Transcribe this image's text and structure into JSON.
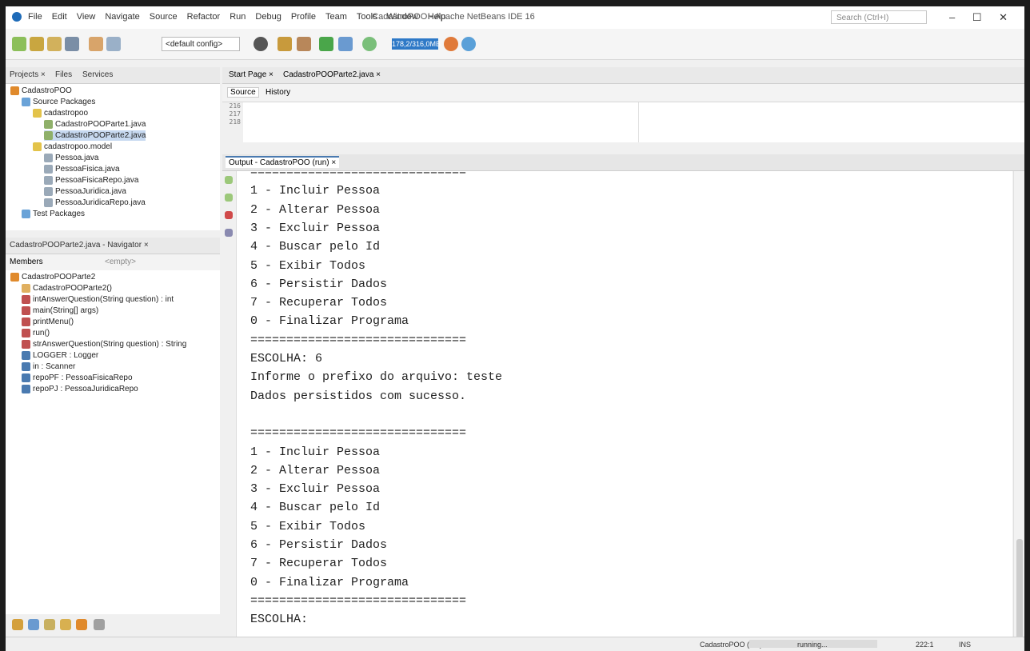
{
  "window": {
    "title": "CadastroPOO - Apache NetBeans IDE 16",
    "search_placeholder": "Search (Ctrl+I)",
    "min": "–",
    "max": "☐",
    "close": "✕"
  },
  "menu": [
    "File",
    "Edit",
    "View",
    "Navigate",
    "Source",
    "Refactor",
    "Run",
    "Debug",
    "Profile",
    "Team",
    "Tools",
    "Window",
    "Help"
  ],
  "toolbar": {
    "config": "<default config>",
    "memory": "178,2/316,0MB"
  },
  "projects_panel": {
    "tabs": [
      "Projects ×",
      "Files",
      "Services"
    ],
    "tree": [
      {
        "label": "CadastroPOO",
        "indent": 0,
        "color": "#e08a2c"
      },
      {
        "label": "Source Packages",
        "indent": 1,
        "color": "#6aa3d8"
      },
      {
        "label": "cadastropoo",
        "indent": 2,
        "color": "#e3c34a"
      },
      {
        "label": "CadastroPOOParte1.java",
        "indent": 3,
        "color": "#8fb06a"
      },
      {
        "label": "CadastroPOOParte2.java",
        "indent": 3,
        "color": "#8fb06a",
        "selected": true
      },
      {
        "label": "cadastropoo.model",
        "indent": 2,
        "color": "#e3c34a"
      },
      {
        "label": "Pessoa.java",
        "indent": 3,
        "color": "#9aa9b8"
      },
      {
        "label": "PessoaFisica.java",
        "indent": 3,
        "color": "#9aa9b8"
      },
      {
        "label": "PessoaFisicaRepo.java",
        "indent": 3,
        "color": "#9aa9b8"
      },
      {
        "label": "PessoaJuridica.java",
        "indent": 3,
        "color": "#9aa9b8"
      },
      {
        "label": "PessoaJuridicaRepo.java",
        "indent": 3,
        "color": "#9aa9b8"
      },
      {
        "label": "Test Packages",
        "indent": 1,
        "color": "#6aa3d8"
      }
    ]
  },
  "navigator": {
    "title": "CadastroPOOParte2.java - Navigator ×",
    "filter": "Members",
    "empty": "<empty>",
    "members": [
      {
        "label": "CadastroPOOParte2",
        "indent": 0,
        "color": "#e08a2c"
      },
      {
        "label": "CadastroPOOParte2()",
        "indent": 1,
        "color": "#e0b060"
      },
      {
        "label": "intAnswerQuestion(String question) : int",
        "indent": 1,
        "color": "#c05050"
      },
      {
        "label": "main(String[] args)",
        "indent": 1,
        "color": "#c05050"
      },
      {
        "label": "printMenu()",
        "indent": 1,
        "color": "#c05050"
      },
      {
        "label": "run()",
        "indent": 1,
        "color": "#c05050"
      },
      {
        "label": "strAnswerQuestion(String question) : String",
        "indent": 1,
        "color": "#c05050"
      },
      {
        "label": "LOGGER : Logger",
        "indent": 1,
        "color": "#4a7ab0"
      },
      {
        "label": "in : Scanner",
        "indent": 1,
        "color": "#4a7ab0"
      },
      {
        "label": "repoPF : PessoaFisicaRepo",
        "indent": 1,
        "color": "#4a7ab0"
      },
      {
        "label": "repoPJ : PessoaJuridicaRepo",
        "indent": 1,
        "color": "#4a7ab0"
      }
    ]
  },
  "editor": {
    "tabs": [
      "Start Page ×",
      "CadastroPOOParte2.java ×"
    ],
    "source_label": "Source",
    "history_label": "History",
    "line_numbers": [
      "216",
      "217",
      "218"
    ]
  },
  "output": {
    "title": "Output - CadastroPOO (run) ×",
    "lines": [
      "==============================",
      "1 - Incluir Pessoa",
      "2 - Alterar Pessoa",
      "3 - Excluir Pessoa",
      "4 - Buscar pelo Id",
      "5 - Exibir Todos",
      "6 - Persistir Dados",
      "7 - Recuperar Todos",
      "0 - Finalizar Programa",
      "==============================",
      "ESCOLHA: 6",
      "Informe o prefixo do arquivo: teste",
      "Dados persistidos com sucesso.",
      "",
      "==============================",
      "1 - Incluir Pessoa",
      "2 - Alterar Pessoa",
      "3 - Excluir Pessoa",
      "4 - Buscar pelo Id",
      "5 - Exibir Todos",
      "6 - Persistir Dados",
      "7 - Recuperar Todos",
      "0 - Finalizar Programa",
      "==============================",
      "ESCOLHA:"
    ]
  },
  "status": {
    "process": "CadastroPOO (run)",
    "state": "running...",
    "position": "222:1",
    "mode": "INS"
  }
}
